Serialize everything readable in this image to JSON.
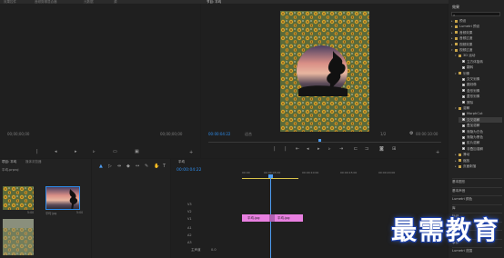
{
  "top_tabs": [
    "效果控件",
    "音频剪辑混合器",
    "元数据",
    "源",
    "节目: 平均"
  ],
  "source_monitor": {
    "timecode_left": "00;00;00;00",
    "timecode_right": "00;00;00;00"
  },
  "program_monitor": {
    "timecode": "00:00:04:22",
    "fit_label": "适合",
    "scale_label": "1/2",
    "duration": "00:00:10:00"
  },
  "effects_panel": {
    "title": "效果",
    "items": [
      {
        "label": "预设",
        "indent": 1,
        "type": "folder"
      },
      {
        "label": "Lumetri 预设",
        "indent": 1,
        "type": "folder"
      },
      {
        "label": "音频效果",
        "indent": 1,
        "type": "folder"
      },
      {
        "label": "音频过渡",
        "indent": 1,
        "type": "folder"
      },
      {
        "label": "视频效果",
        "indent": 1,
        "type": "folder"
      },
      {
        "label": "视频过渡",
        "indent": 1,
        "type": "folder-open"
      },
      {
        "label": "3D 运动",
        "indent": 2,
        "type": "folder-open"
      },
      {
        "label": "立方体旋转",
        "indent": 3,
        "type": "effect"
      },
      {
        "label": "翻转",
        "indent": 3,
        "type": "effect"
      },
      {
        "label": "划像",
        "indent": 2,
        "type": "folder-open"
      },
      {
        "label": "交叉划像",
        "indent": 3,
        "type": "effect"
      },
      {
        "label": "圆划像",
        "indent": 3,
        "type": "effect"
      },
      {
        "label": "盒形划像",
        "indent": 3,
        "type": "effect"
      },
      {
        "label": "菱形划像",
        "indent": 3,
        "type": "effect"
      },
      {
        "label": "擦除",
        "indent": 3,
        "type": "effect"
      },
      {
        "label": "溶解",
        "indent": 2,
        "type": "folder-open"
      },
      {
        "label": "MorphCut",
        "indent": 3,
        "type": "effect"
      },
      {
        "label": "交叉溶解",
        "indent": 3,
        "type": "effect",
        "selected": true
      },
      {
        "label": "叠加溶解",
        "indent": 3,
        "type": "effect"
      },
      {
        "label": "渐隐为白色",
        "indent": 3,
        "type": "effect"
      },
      {
        "label": "渐隐为黑色",
        "indent": 3,
        "type": "effect"
      },
      {
        "label": "胶片溶解",
        "indent": 3,
        "type": "effect"
      },
      {
        "label": "非叠加溶解",
        "indent": 3,
        "type": "effect"
      },
      {
        "label": "滑动",
        "indent": 2,
        "type": "folder"
      },
      {
        "label": "缩放",
        "indent": 2,
        "type": "folder"
      },
      {
        "label": "页面剥落",
        "indent": 2,
        "type": "folder"
      }
    ],
    "bottom_items": [
      "基本图形",
      "基本声音",
      "Lumetri 颜色",
      "库",
      "标记",
      "历史记录",
      "信息",
      "事件",
      "Lumetri 范围"
    ]
  },
  "project_panel": {
    "tabs": [
      "项目: 平均",
      "媒体浏览器"
    ],
    "file_label": "平均.prproj",
    "items": [
      {
        "name": "平均.jpg",
        "duration": "5:00"
      },
      {
        "name": "平均 jpg",
        "duration": "5:00"
      },
      {
        "name": "",
        "duration": ""
      }
    ]
  },
  "timeline": {
    "tab": "平均",
    "timecode": "00:00:04:22",
    "ruler": [
      "00:00",
      "00:00:05:00",
      "00:00:10:00",
      "00:00:15:00",
      "00:00:20:00"
    ],
    "tracks": [
      "V3",
      "V2",
      "V1",
      "A1",
      "A2",
      "A3"
    ],
    "master": "主声道",
    "master_value": "0.0",
    "clips": [
      {
        "label": "平均.jpg"
      },
      {
        "label": "平均.jpg"
      }
    ]
  },
  "watermark": "最需教育",
  "colors": {
    "accent": "#2d8ceb",
    "clip": "#e87fe0",
    "playhead": "#4d9cf0"
  }
}
